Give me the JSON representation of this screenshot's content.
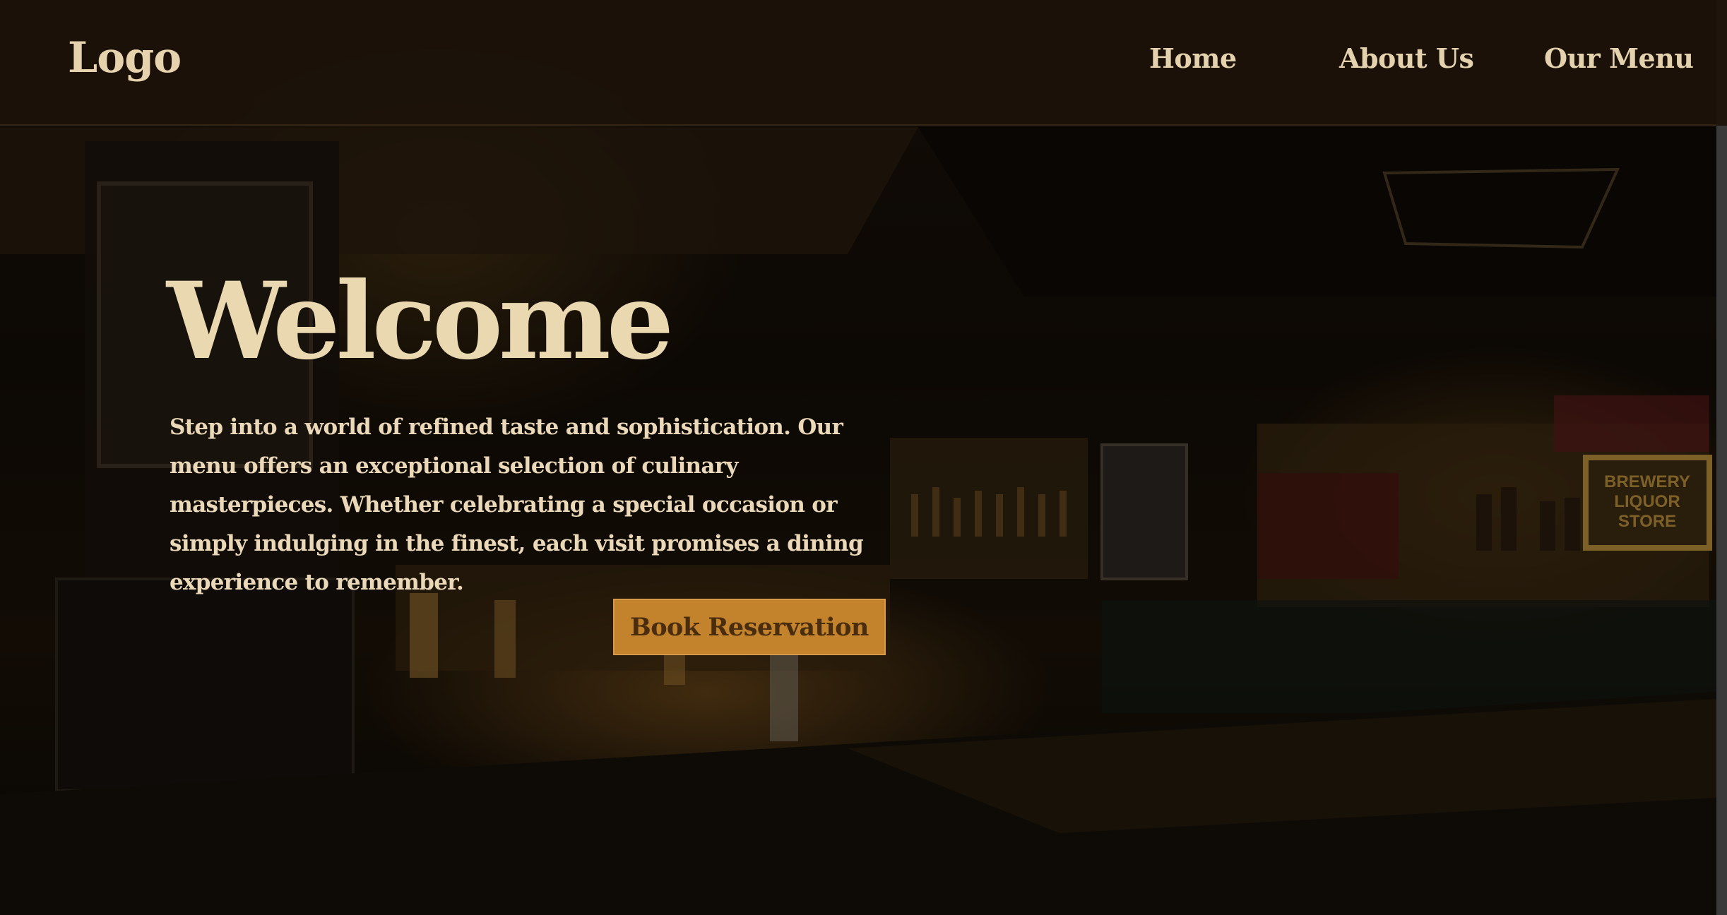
{
  "header": {
    "logo": "Logo",
    "nav": {
      "home": "Home",
      "about": "About Us",
      "menu": "Our Menu"
    }
  },
  "hero": {
    "title": "Welcome",
    "description": "Step into a world of refined taste and sophistication. Our menu offers an exceptional selection of culinary masterpieces. Whether celebrating a special occasion or simply indulging in the finest, each visit promises a dining experience to remember.",
    "cta_label": "Book Reservation",
    "background_image": "restaurant-bar-interior",
    "sign_text": [
      "BREWERY",
      "LIQUOR",
      "STORE"
    ]
  },
  "colors": {
    "header_bg": "#1c120a",
    "text_cream": "#ead8b1",
    "button_bg": "#c3832c",
    "button_text": "#4a2c0e"
  }
}
